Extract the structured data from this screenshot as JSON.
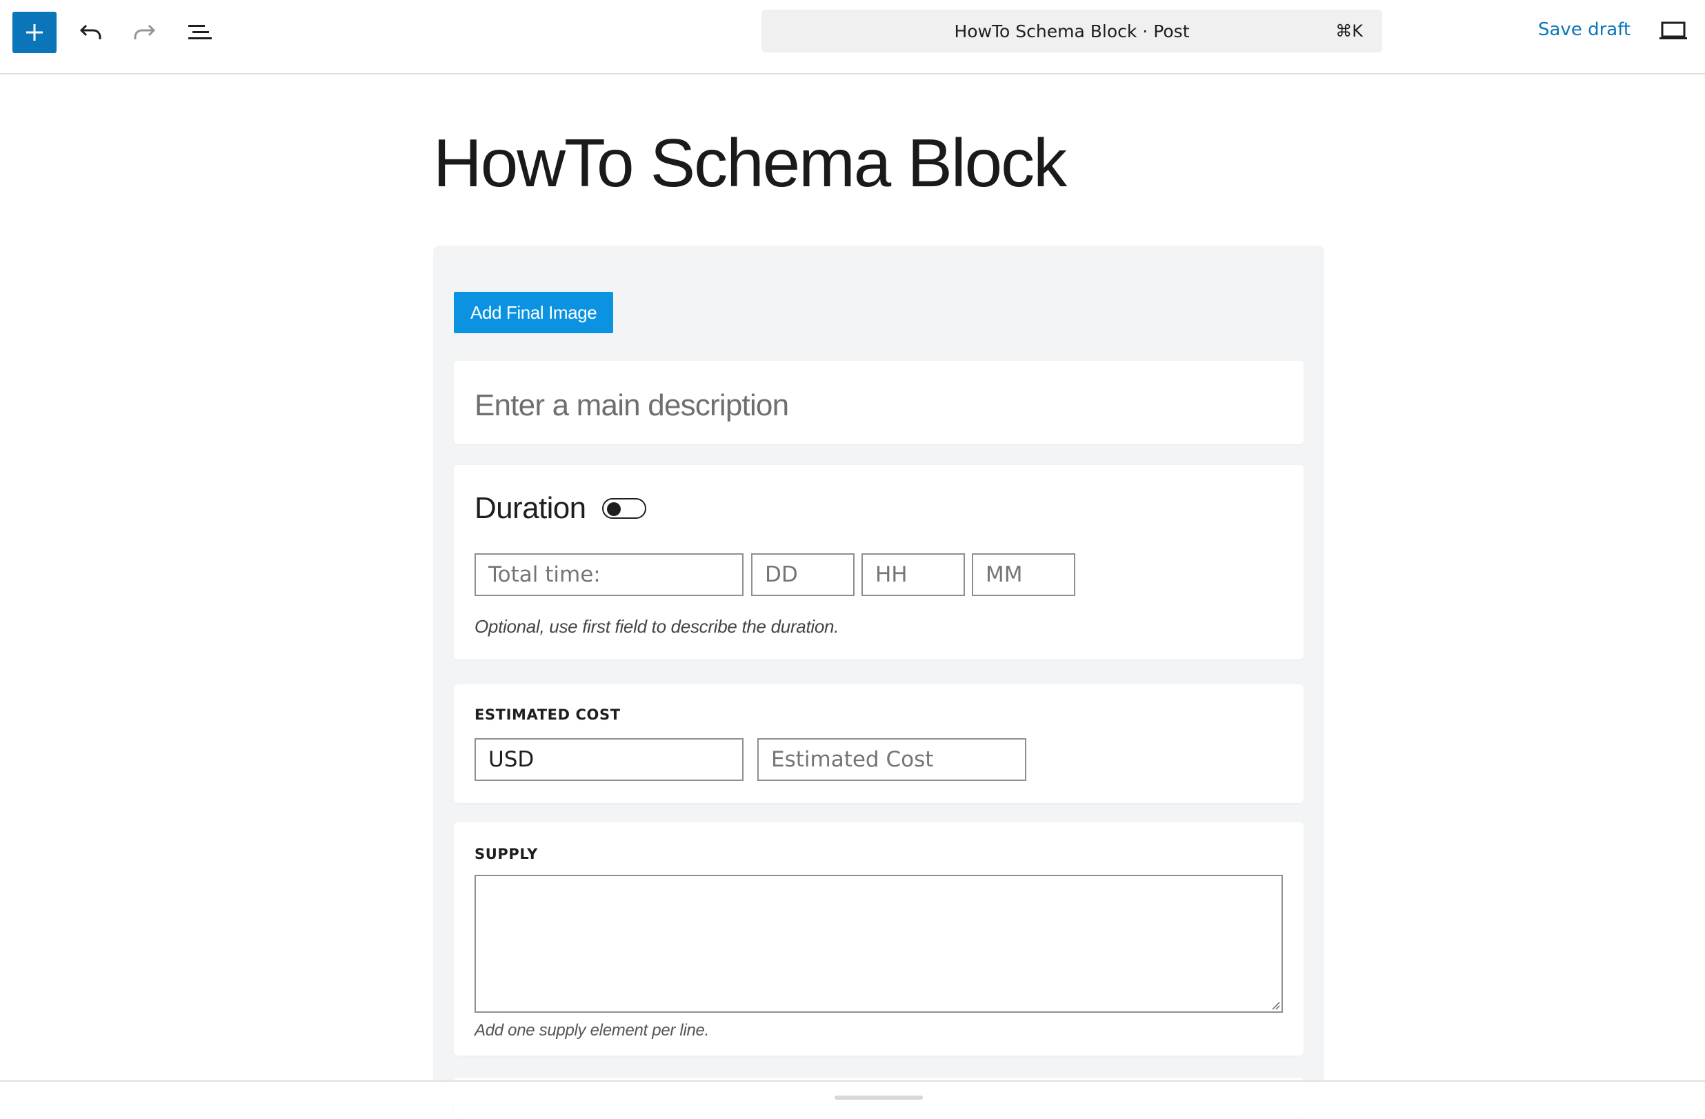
{
  "toolbar": {
    "document_title": "HowTo Schema Block · Post",
    "shortcut": "⌘K",
    "save_draft_label": "Save draft",
    "icons": [
      "plus-icon",
      "undo-icon",
      "redo-icon",
      "list-view-icon",
      "desktop-preview-icon"
    ],
    "accent_color": "#0a76b9"
  },
  "post": {
    "title": "HowTo Schema Block"
  },
  "howto": {
    "final_image_button": "Add Final Image",
    "main_description_placeholder": "Enter a main description",
    "duration": {
      "label": "Duration",
      "toggle_on": false,
      "total_time_placeholder": "Total time:",
      "days_placeholder": "DD",
      "hours_placeholder": "HH",
      "minutes_placeholder": "MM",
      "help": "Optional, use first field to describe the duration."
    },
    "estimated_cost": {
      "label": "ESTIMATED COST",
      "currency_value": "USD",
      "cost_placeholder": "Estimated Cost"
    },
    "supply": {
      "label": "SUPPLY",
      "value": "",
      "help": "Add one supply element per line."
    }
  }
}
